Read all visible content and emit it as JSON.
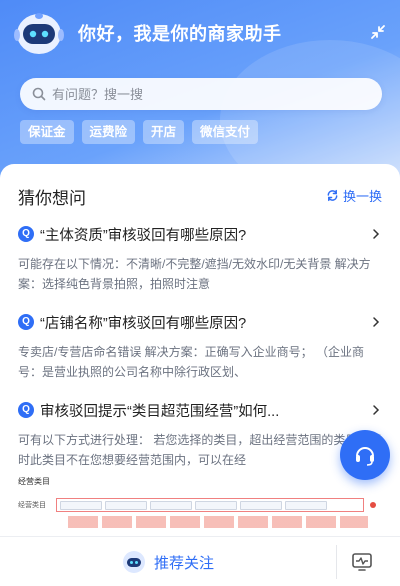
{
  "header": {
    "greeting": "你好，我是你的商家助手",
    "search_placeholder": "有问题？搜一搜",
    "quick_tags": [
      "保证金",
      "运费险",
      "开店",
      "微信支付"
    ]
  },
  "guess": {
    "title": "猜你想问",
    "refresh_label": "换一换",
    "questions": [
      {
        "badge": "Q",
        "title": "“主体资质”审核驳回有哪些原因?",
        "desc": "可能存在以下情况：不清晰/不完整/遮挡/无效水印/无关背景 解决方案：选择纯色背景拍照，拍照时注意"
      },
      {
        "badge": "Q",
        "title": "“店铺名称”审核驳回有哪些原因?",
        "desc": "专卖店/专营店命名错误 解决方案：正确写入企业商号；  （企业商号：是营业执照的公司名称中除行政区划、"
      },
      {
        "badge": "Q",
        "title": "审核驳回提示“类目超范围经营”如何...",
        "desc": "可有以下方式进行处理：  若您选择的类目，超出经营范围的类目，同时此类目不在您想要经营范围内，可以在经"
      }
    ],
    "preview_title": "经营类目",
    "preview_row_label": "经营类目"
  },
  "bottom": {
    "recommend_label": "推荐关注"
  },
  "colors": {
    "accent": "#2f6ef6",
    "header_start": "#4f8bf7",
    "muted_text": "#6b7280"
  },
  "icons": {
    "avatar": "robot-avatar-icon",
    "collapse": "collapse-arrows-icon",
    "search": "search-icon",
    "refresh": "refresh-icon",
    "arrow": "chevron-right-icon",
    "support": "headset-icon",
    "monitor": "monitor-icon"
  }
}
